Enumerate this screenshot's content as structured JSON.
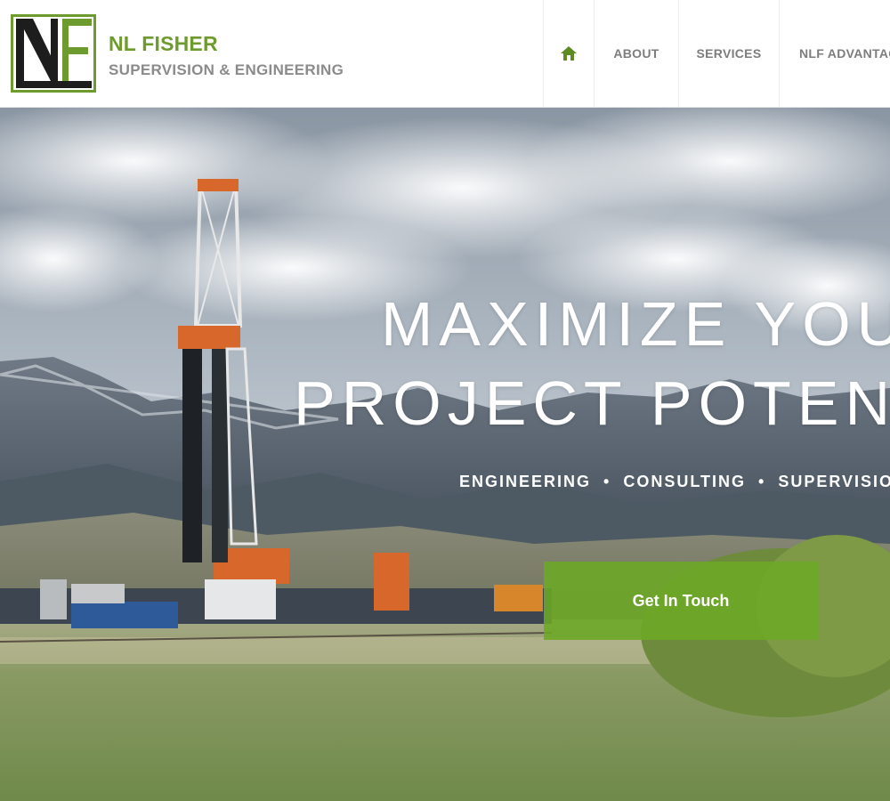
{
  "brand": {
    "name": "NL FISHER",
    "tagline": "SUPERVISION & ENGINEERING",
    "logo_letters": "NF",
    "accent_color": "#6e9b2e"
  },
  "nav": {
    "home_icon": "home-icon",
    "items": [
      {
        "label": "ABOUT"
      },
      {
        "label": "SERVICES"
      },
      {
        "label": "NLF ADVANTAGE"
      }
    ]
  },
  "hero": {
    "title_line1": "MAXIMIZE YOUR",
    "title_line2": "PROJECT POTENTIAL",
    "subtitle_items": [
      "ENGINEERING",
      "CONSULTING",
      "SUPERVISION"
    ],
    "separator": "•",
    "cta_label": "Get In Touch",
    "cta_color": "#6ca826"
  }
}
